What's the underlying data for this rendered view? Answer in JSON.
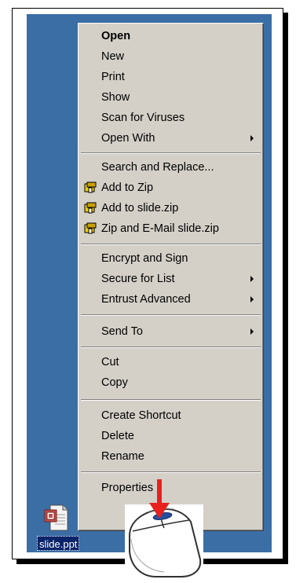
{
  "menu": {
    "items": [
      {
        "label": "Open",
        "bold": true
      },
      {
        "label": "New"
      },
      {
        "label": "Print"
      },
      {
        "label": "Show"
      },
      {
        "label": "Scan for Viruses"
      },
      {
        "label": "Open With",
        "submenu": true
      },
      {
        "label": "Search and Replace..."
      },
      {
        "label": "Add to Zip",
        "icon": "winzip-icon"
      },
      {
        "label": "Add to slide.zip",
        "icon": "winzip-icon"
      },
      {
        "label": "Zip and E-Mail slide.zip",
        "icon": "winzip-icon"
      },
      {
        "label": "Encrypt and Sign"
      },
      {
        "label": "Secure for List",
        "submenu": true
      },
      {
        "label": "Entrust Advanced",
        "submenu": true
      },
      {
        "label": "Send To",
        "submenu": true
      },
      {
        "label": "Cut"
      },
      {
        "label": "Copy"
      },
      {
        "label": "Create Shortcut"
      },
      {
        "label": "Delete"
      },
      {
        "label": "Rename"
      },
      {
        "label": "Properties"
      }
    ]
  },
  "desktop": {
    "file_label": "slide.ppt",
    "file_icon": "powerpoint-file-icon"
  },
  "colors": {
    "desktop": "#3a6ea5",
    "menu": "#d4d0c8",
    "selection": "#0a246a",
    "pointer_arrow": "#e8201e"
  }
}
